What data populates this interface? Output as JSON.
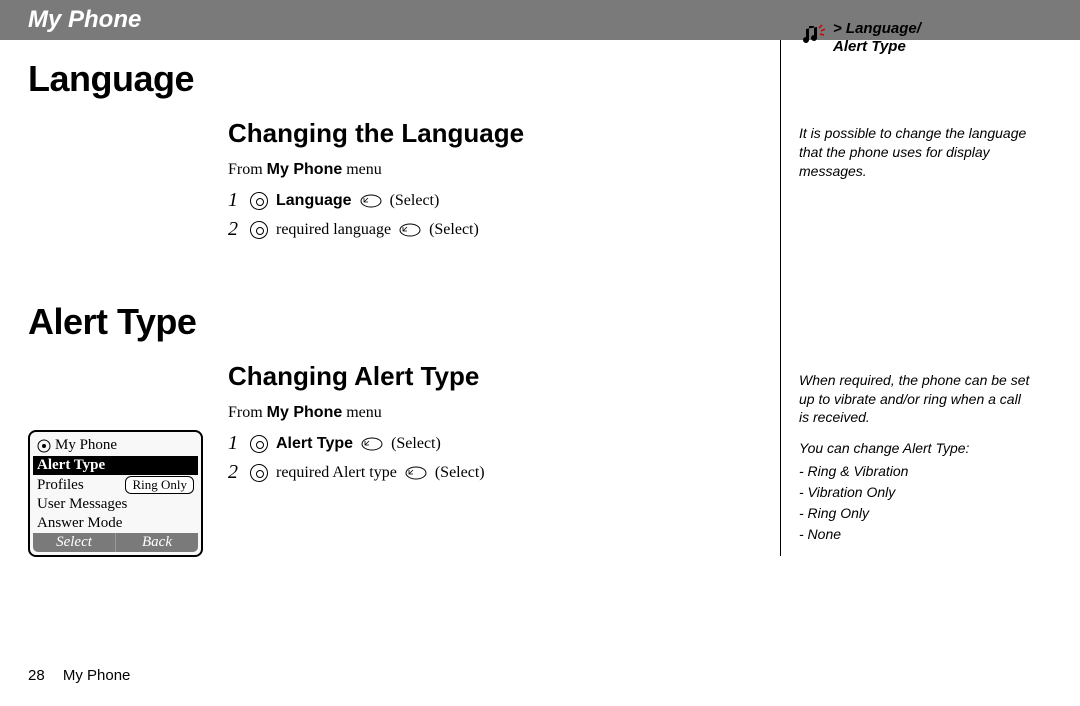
{
  "header": {
    "title": "My Phone"
  },
  "breadcrumb": {
    "line1": "> Language/",
    "line2": "Alert Type"
  },
  "section1": {
    "h1": "Language",
    "h2": "Changing the Language",
    "from_prefix": "From ",
    "from_bold": "My Phone",
    "from_suffix": " menu",
    "step1_num": "1",
    "step1_bold": "Language",
    "step1_action": "(Select)",
    "step2_num": "2",
    "step2_text": "required language",
    "step2_action": "(Select)"
  },
  "section2": {
    "h1": "Alert Type",
    "h2": "Changing Alert Type",
    "from_prefix": "From ",
    "from_bold": "My Phone",
    "from_suffix": " menu",
    "step1_num": "1",
    "step1_bold": "Alert Type",
    "step1_action": "(Select)",
    "step2_num": "2",
    "step2_text": "required Alert type",
    "step2_action": "(Select)"
  },
  "phone": {
    "title": "My Phone",
    "rows": [
      "Alert Type",
      "Profiles",
      "User Messages",
      "Answer Mode"
    ],
    "badge": "Ring Only",
    "soft_left": "Select",
    "soft_right": "Back"
  },
  "sidebar": {
    "note1": "It is possible to change the language that the phone uses for display messages.",
    "note2a": "When required, the phone can be set up to vibrate and/or ring when a call is received.",
    "note2b": "You can change Alert Type:",
    "opts": [
      "- Ring & Vibration",
      "- Vibration Only",
      "- Ring Only",
      "- None"
    ]
  },
  "footer": {
    "page": "28",
    "label": "My Phone"
  }
}
